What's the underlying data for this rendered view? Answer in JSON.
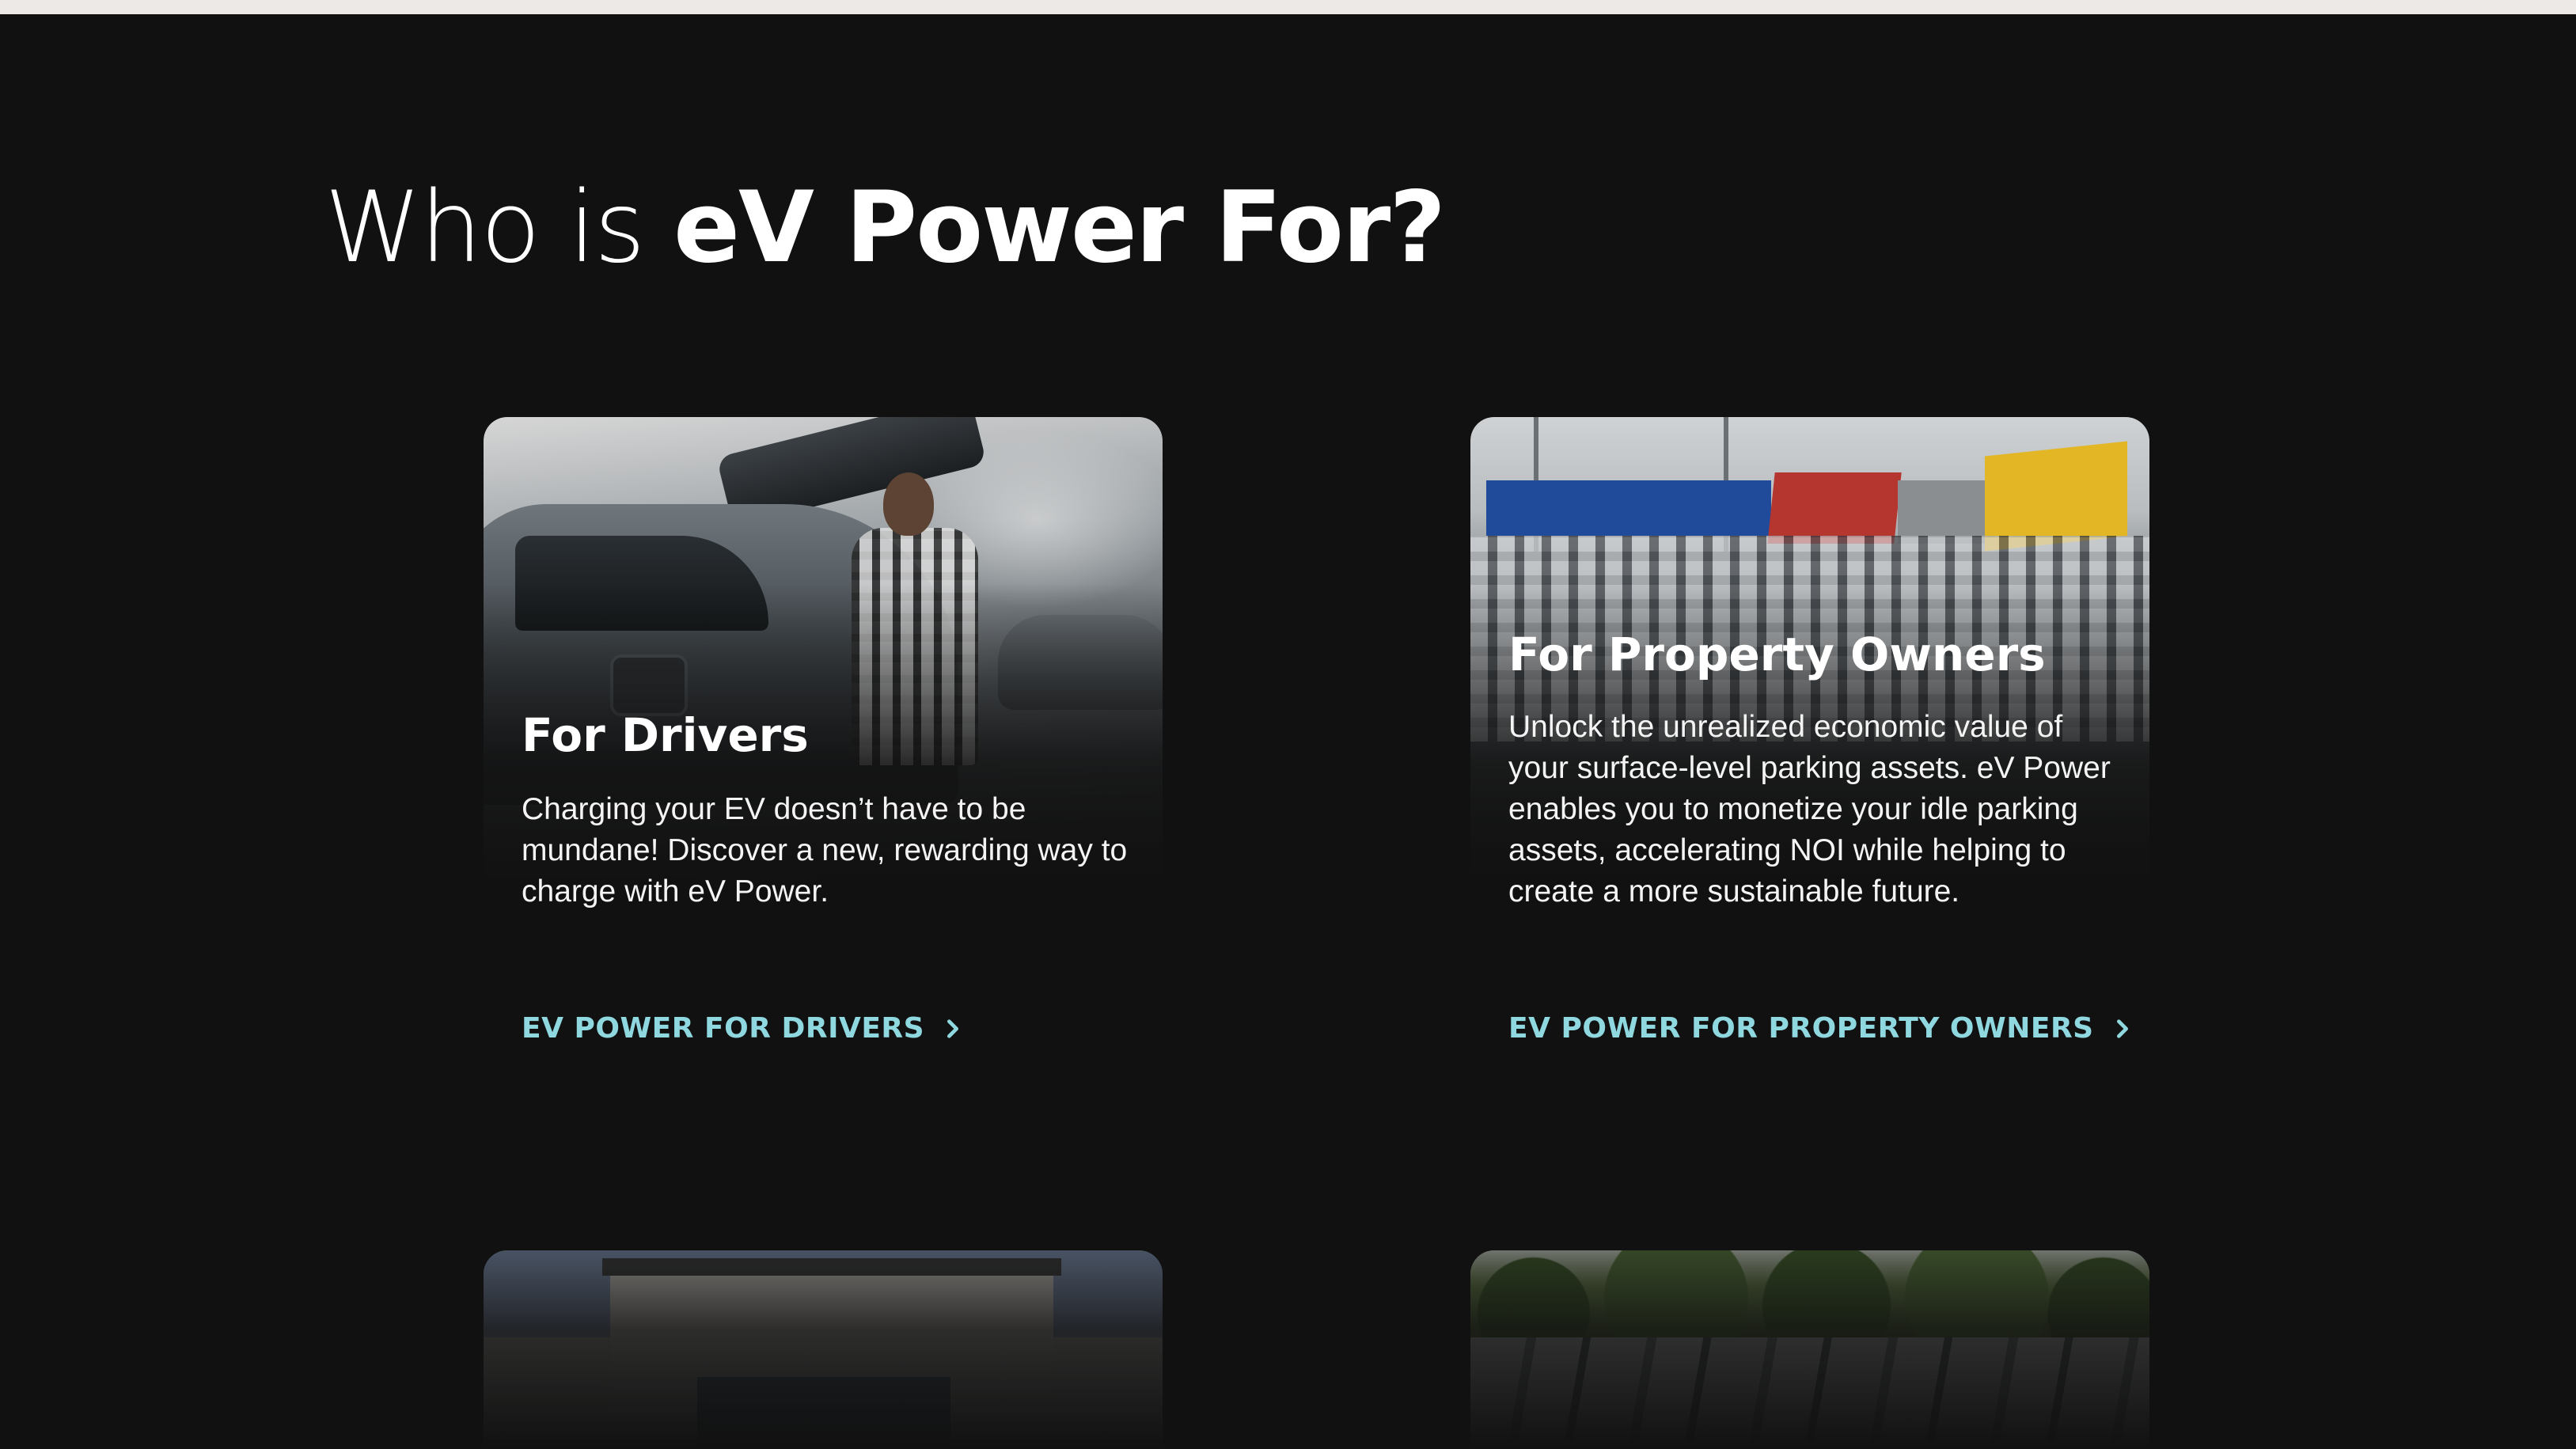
{
  "section": {
    "title_light": "Who is ",
    "title_bold": "eV Power For?"
  },
  "cards": [
    {
      "title": "For Drivers",
      "description": "Charging your EV doesn’t have to be mundane! Discover a new, rewarding way to charge with eV Power.",
      "link_label": "EV POWER FOR DRIVERS",
      "link_icon": "chevron-right-icon",
      "image": "driver-charging-car-photo"
    },
    {
      "title": "For Property Owners",
      "description": "Unlock the unrealized economic value of your surface-level parking assets. eV Power enables you to monetize your idle parking assets, accelerating NOI while helping to create a more sustainable future.",
      "link_label": "EV POWER FOR PROPERTY OWNERS",
      "link_icon": "chevron-right-icon",
      "image": "parking-lot-photo"
    },
    {
      "image": "commercial-building-photo"
    },
    {
      "image": "fleet-vans-photo"
    }
  ],
  "colors": {
    "background": "#111111",
    "top_strip": "#ece9e6",
    "link": "#8fd8e0",
    "text": "#ffffff"
  }
}
